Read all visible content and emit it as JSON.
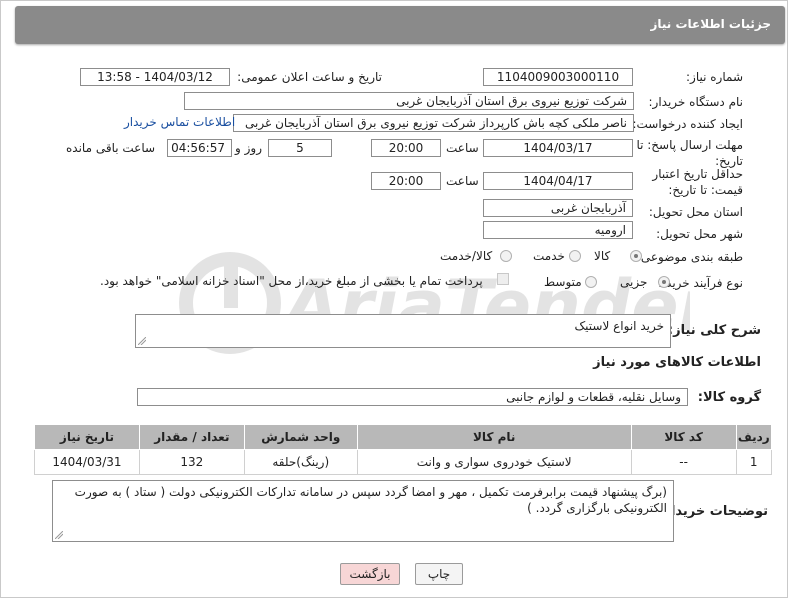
{
  "header": {
    "title": "جزئیات اطلاعات نیاز"
  },
  "need_number": {
    "label": "شماره نیاز:",
    "value": "1104009003000110"
  },
  "announce_datetime": {
    "label": "تاریخ و ساعت اعلان عمومی:",
    "value": "1404/03/12 - 13:58"
  },
  "buyer_org": {
    "label": "نام دستگاه خریدار:",
    "value": "شرکت توزیع نیروی برق استان آذربایجان غربی"
  },
  "requester": {
    "label": "ایجاد کننده درخواست:",
    "value": "ناصر ملکی کچه باش کارپرداز شرکت توزیع نیروی برق استان آذربایجان غربی",
    "contact_link": "اطلاعات تماس خریدار"
  },
  "reply_deadline": {
    "label": "مهلت ارسال پاسخ: تا تاریخ:",
    "date": "1404/03/17",
    "time_label": "ساعت",
    "time": "20:00",
    "days": "5",
    "days_label": "روز و",
    "remaining": "04:56:57",
    "remaining_label": "ساعت باقی مانده"
  },
  "price_validity": {
    "label": "حداقل تاریخ اعتبار قیمت: تا تاریخ:",
    "date": "1404/04/17",
    "time_label": "ساعت",
    "time": "20:00"
  },
  "delivery_province": {
    "label": "استان محل تحویل:",
    "value": "آذربایجان غربی"
  },
  "delivery_city": {
    "label": "شهر محل تحویل:",
    "value": "ارومیه"
  },
  "category": {
    "label": "طبقه بندی موضوعی:",
    "options": [
      "کالا",
      "خدمت",
      "کالا/خدمت"
    ],
    "selected": "کالا"
  },
  "purchase_process": {
    "label": "نوع فرآیند خرید :",
    "options": [
      "جزیی",
      "متوسط"
    ],
    "selected": "جزیی",
    "payment_note": "پرداخت تمام یا بخشی از مبلغ خرید،از محل \"اسناد خزانه اسلامی\" خواهد بود."
  },
  "general_description": {
    "label": "شرح کلی نیاز:",
    "value": "خرید انواع لاستیک"
  },
  "goods_section": {
    "title": "اطلاعات کالاهای مورد نیاز"
  },
  "goods_group": {
    "label": "گروه کالا:",
    "value": "وسایل نقلیه، قطعات و لوازم جانبی"
  },
  "table": {
    "headers": [
      "ردیف",
      "کد کالا",
      "نام کالا",
      "واحد شمارش",
      "تعداد / مقدار",
      "تاریخ نیاز"
    ],
    "rows": [
      [
        "1",
        "--",
        "لاستیک خودروی سواری و وانت",
        "(رینگ)حلقه",
        "132",
        "1404/03/31"
      ]
    ]
  },
  "buyer_notes": {
    "label": "توضیحات خریدار:",
    "value": "(برگ پیشنهاد قیمت برابرفرمت تکمیل ، مهر و امضا گردد سپس در سامانه تدارکات الکترونیکی دولت ( ستاد ) به صورت الکترونیکی  بارگزاری گردد. )"
  },
  "buttons": {
    "print": "چاپ",
    "back": "بازگشت"
  },
  "colors": {
    "header_bg": "#8a8a8a",
    "link": "#1a4fa0",
    "back_button_bg": "#f7d6d6",
    "table_header_bg": "#b8b8b8"
  }
}
